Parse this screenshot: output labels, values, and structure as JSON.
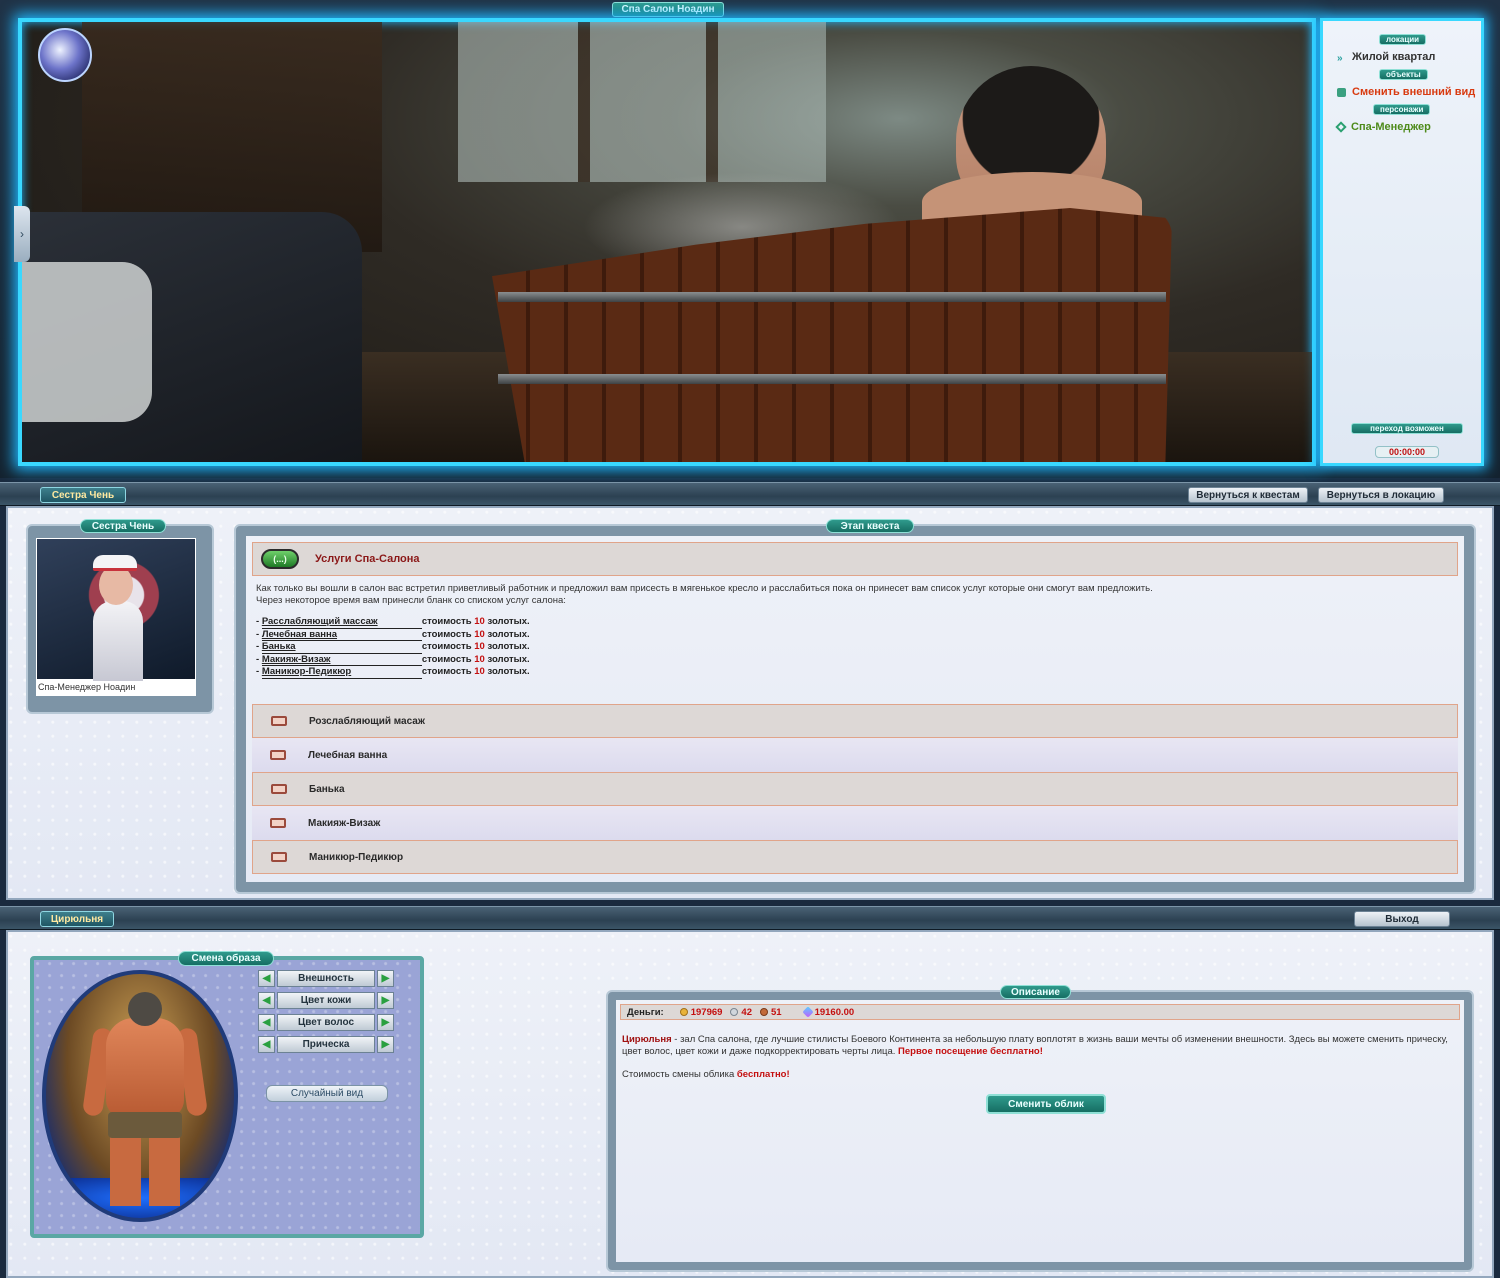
{
  "scene": {
    "title": "Спа Салон Ноадин"
  },
  "locations_panel": {
    "locations_header": "локации",
    "location_item": "Жилой квартал",
    "objects_header": "объекты",
    "object_item": "Сменить внешний вид",
    "characters_header": "персонажи",
    "character_item": "Спа-Менеджер",
    "transition_label": "переход возможен",
    "timer": "00:00:00"
  },
  "quest_bar": {
    "label": "Сестра Чень",
    "back_to_quests": "Вернуться к квестам",
    "back_to_location": "Вернуться в локацию"
  },
  "npc": {
    "header": "Сестра Чень",
    "caption": "Спа-Менеджер Ноадин"
  },
  "quest": {
    "header": "Этап квеста",
    "badge": "(...)",
    "title": "Услуги Спа-Салона",
    "text_line1": "Как только вы вошли в салон вас встретил приветливый работник и предложил вам присесть в мягенькое кресло и расслабиться пока он принесет вам список услуг которые они смогут вам предложить.",
    "text_line2": "Через некоторое время вам принесли бланк со списком услуг салона:",
    "services": [
      {
        "name": "Расслабляющий масcаж",
        "cost_prefix": "стоимость",
        "amount": "10",
        "cost_suffix": "золотых."
      },
      {
        "name": "Лечебная ванна",
        "cost_prefix": "стоимость",
        "amount": "10",
        "cost_suffix": "золотых."
      },
      {
        "name": "Банька",
        "cost_prefix": "стоимость",
        "amount": "10",
        "cost_suffix": "золотых."
      },
      {
        "name": "Макияж-Визаж",
        "cost_prefix": "стоимость",
        "amount": "10",
        "cost_suffix": "золотых."
      },
      {
        "name": "Маникюр-Педикюр",
        "cost_prefix": "стоимость",
        "amount": "10",
        "cost_suffix": "золотых."
      }
    ],
    "choices": [
      "Розслабляющий масаж",
      "Лечебная ванна",
      "Банька",
      "Макияж-Визаж",
      "Маникюр-Педикюр"
    ]
  },
  "barber_bar": {
    "label": "Цирюльня",
    "exit": "Выход"
  },
  "appearance": {
    "header": "Смена образа",
    "options": [
      "Внешность",
      "Цвет кожи",
      "Цвет волос",
      "Прическа"
    ],
    "random": "Случайный вид"
  },
  "description": {
    "header": "Описание",
    "money_label": "Деньги:",
    "gold": "197969",
    "silver": "42",
    "copper": "51",
    "crystals": "19160.00",
    "intro_bold": "Цирюльня",
    "intro_text": " - зал Спа салона, где лучшие стилисты Боевого Континента за небольшую плату воплотят в жизнь ваши мечты об изменении внешности. Здесь вы можете сменить прическу, цвет волос, цвет кожи и даже подкорректировать черты лица. ",
    "first_free": "Первое посещение бесплатно!",
    "price_text": "Стоимость смены облика ",
    "price_value": "бесплатно!",
    "change_button": "Сменить облик"
  },
  "colors": {
    "glow": "#39d8ff",
    "accent_red": "#c41010",
    "teal": "#2f9a8c"
  }
}
